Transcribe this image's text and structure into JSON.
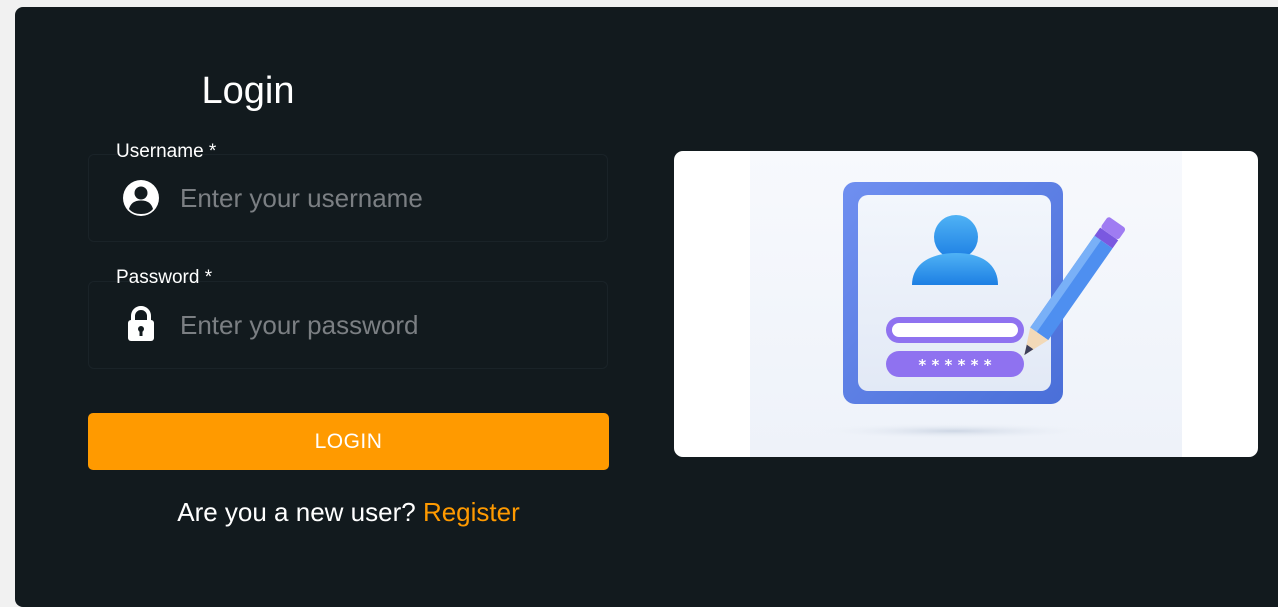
{
  "login_form": {
    "title": "Login",
    "username": {
      "label": "Username *",
      "placeholder": "Enter your username",
      "value": ""
    },
    "password": {
      "label": "Password *",
      "placeholder": "Enter your password",
      "value": ""
    },
    "submit_label": "LOGIN",
    "register_prompt": "Are you a new user?",
    "register_link": "Register"
  },
  "illustration": {
    "mask_text": "* * * * * *"
  },
  "colors": {
    "background": "#121a1e",
    "accent": "#ff9a00",
    "text": "#ffffff",
    "placeholder": "#7b7f83",
    "illustration_card": "#ffffff"
  },
  "icons": {
    "username": "user-circle-icon",
    "password": "lock-icon"
  }
}
